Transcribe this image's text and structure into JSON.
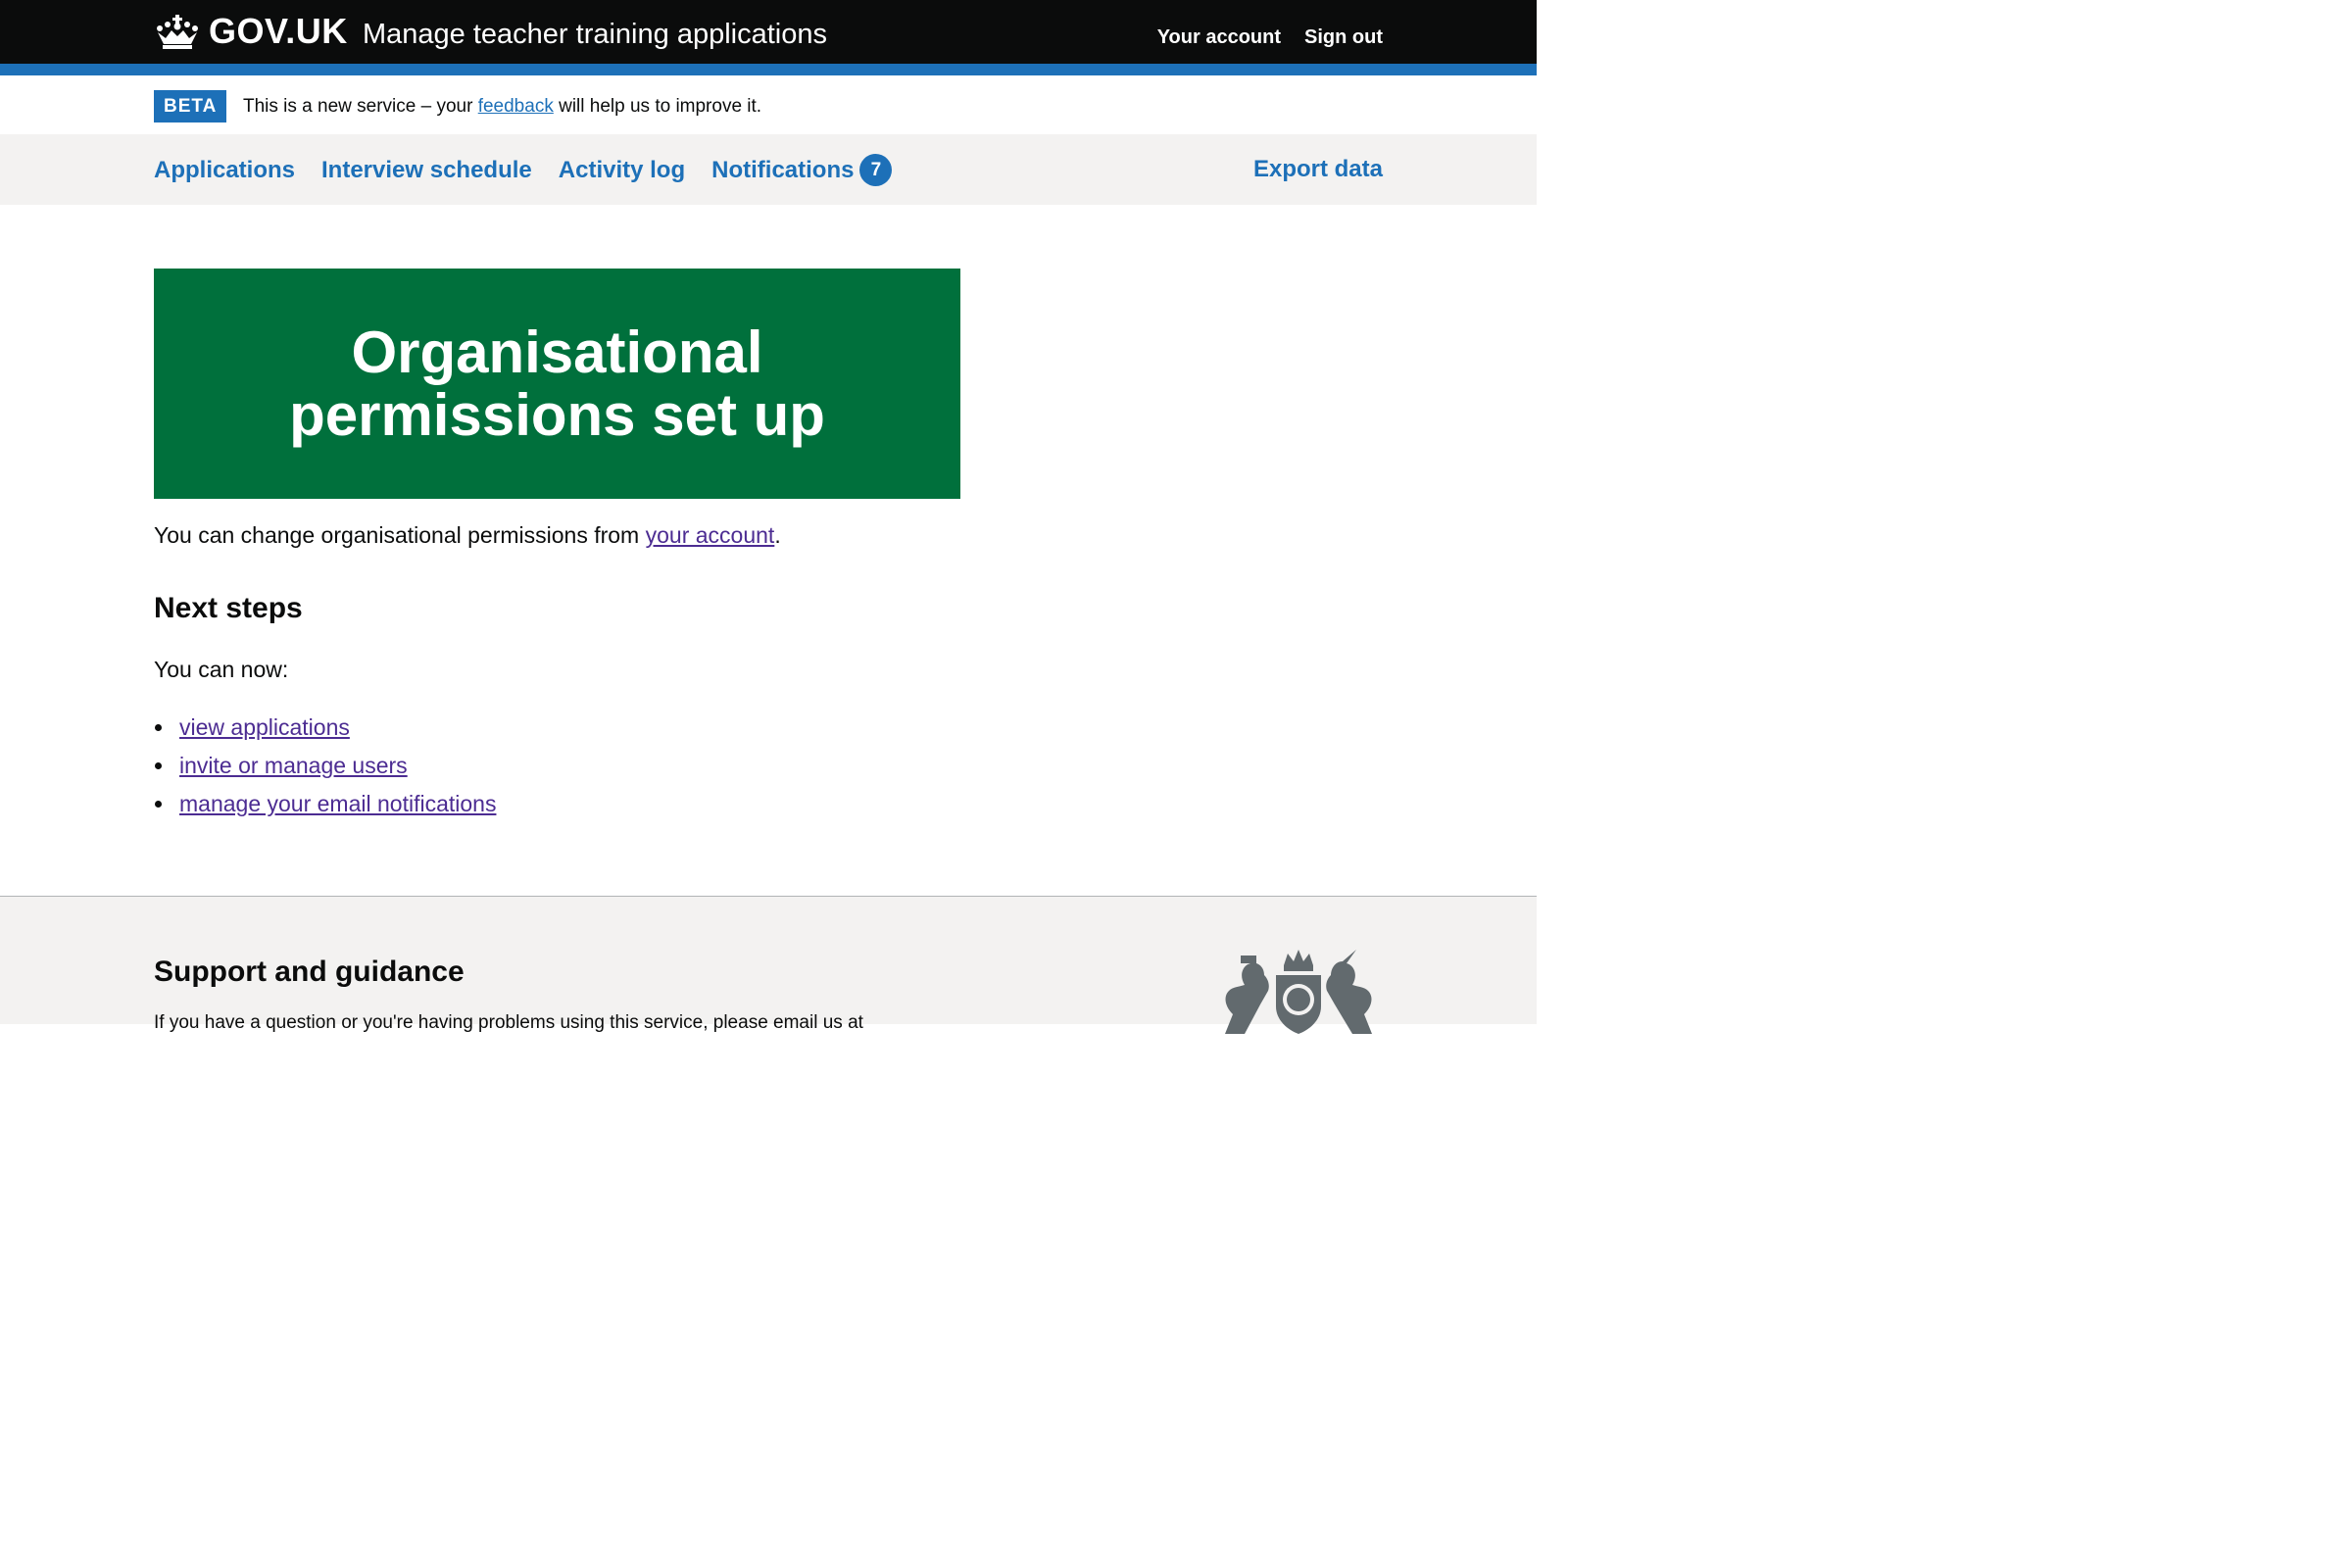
{
  "header": {
    "logo_text": "GOV.UK",
    "service_name": "Manage teacher training applications",
    "links": {
      "your_account": "Your account",
      "sign_out": "Sign out"
    }
  },
  "phase_banner": {
    "tag": "BETA",
    "text_before": "This is a new service – your ",
    "link": "feedback",
    "text_after": " will help us to improve it."
  },
  "nav": {
    "applications": "Applications",
    "interview_schedule": "Interview schedule",
    "activity_log": "Activity log",
    "notifications": "Notifications",
    "notifications_count": "7",
    "export_data": "Export data"
  },
  "confirmation": {
    "title_line1": "Organisational",
    "title_line2": "permissions set up"
  },
  "main": {
    "body_before": "You can change organisational permissions from ",
    "body_link": "your account",
    "body_after": ".",
    "next_steps_heading": "Next steps",
    "can_now": "You can now:",
    "steps": [
      "view applications",
      "invite or manage users",
      "manage your email notifications"
    ]
  },
  "footer": {
    "title": "Support and guidance",
    "text": "If you have a question or you're having problems using this service, please email us at"
  },
  "colors": {
    "header_bg": "#0b0c0c",
    "brand_blue": "#1d70b8",
    "success_green": "#00703c",
    "visited_link": "#4c2c92",
    "nav_bg": "#f3f2f1"
  }
}
